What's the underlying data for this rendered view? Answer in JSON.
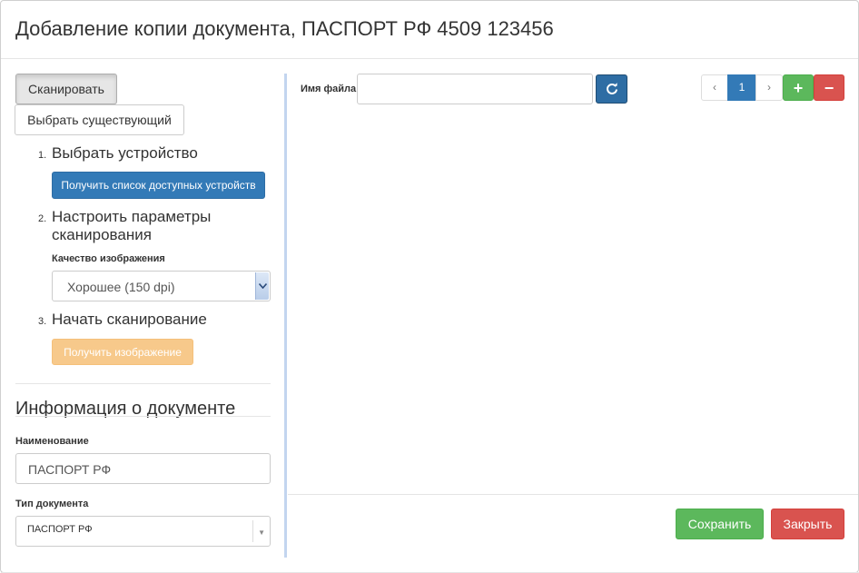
{
  "dialog": {
    "title": "Добавление копии документа, ПАСПОРТ РФ 4509 123456"
  },
  "source_tabs": {
    "scan_label": "Сканировать",
    "existing_label": "Выбрать существующий",
    "active": "scan"
  },
  "scan_steps": [
    {
      "number": "1.",
      "title": "Выбрать устройство",
      "button": "Получить список доступных устройств"
    },
    {
      "number": "2.",
      "title_line1": "Настроить параметры",
      "title_line2": "сканирования",
      "quality_label": "Качество изображения",
      "quality_value": "Хорошее (150 dpi)"
    },
    {
      "number": "3.",
      "title": "Начать сканирование",
      "button": "Получить изображение"
    }
  ],
  "document_info": {
    "heading": "Информация о документе",
    "name_label": "Наименование",
    "name_value": "ПАСПОРТ РФ",
    "type_label": "Тип документа",
    "type_value": "ПАСПОРТ РФ"
  },
  "file_panel": {
    "file_name_label": "Имя файла",
    "file_name_value": "",
    "refresh_icon": "refresh-icon"
  },
  "pagination": {
    "prev": "‹",
    "current": "1",
    "next": "›",
    "add": "+",
    "remove": "−"
  },
  "footer": {
    "save_label": "Сохранить",
    "close_label": "Закрыть"
  },
  "colors": {
    "primary": "#337ab7",
    "success": "#5cb85c",
    "danger": "#d9534f",
    "warning_disabled": "#f7c98b"
  }
}
